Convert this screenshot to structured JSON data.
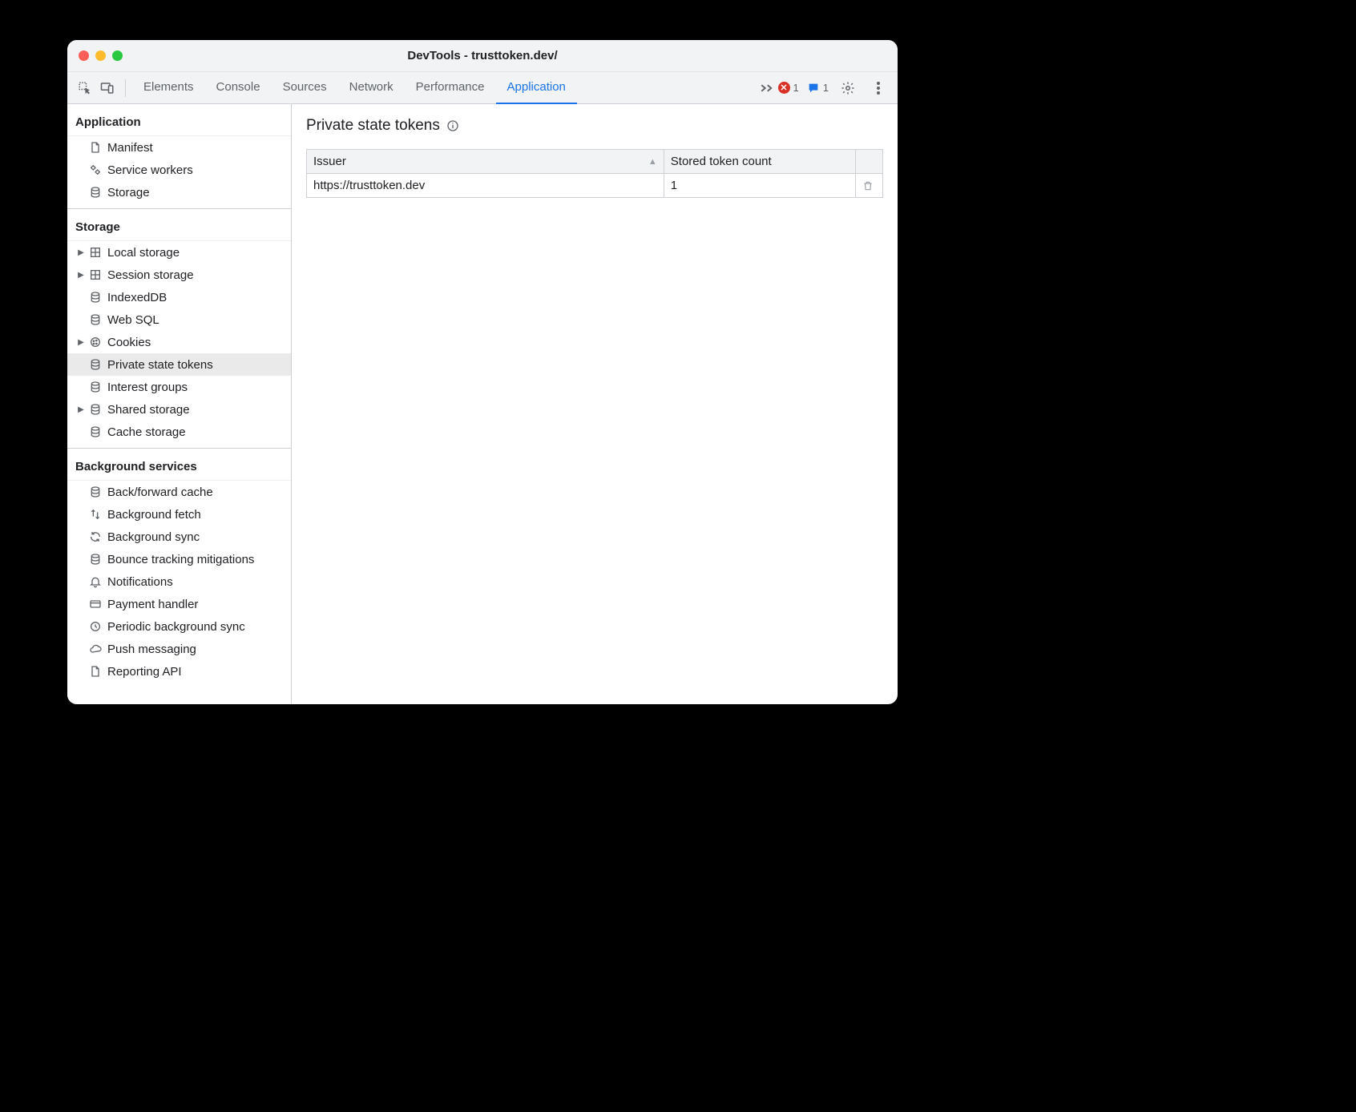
{
  "window": {
    "title": "DevTools - trusttoken.dev/"
  },
  "toolbar": {
    "tabs": [
      "Elements",
      "Console",
      "Sources",
      "Network",
      "Performance",
      "Application"
    ],
    "active_tab": "Application",
    "error_count": "1",
    "message_count": "1"
  },
  "sidebar": {
    "sections": [
      {
        "title": "Application",
        "items": [
          {
            "label": "Manifest",
            "icon": "file"
          },
          {
            "label": "Service workers",
            "icon": "gears"
          },
          {
            "label": "Storage",
            "icon": "db"
          }
        ]
      },
      {
        "title": "Storage",
        "items": [
          {
            "label": "Local storage",
            "icon": "grid",
            "expandable": true
          },
          {
            "label": "Session storage",
            "icon": "grid",
            "expandable": true
          },
          {
            "label": "IndexedDB",
            "icon": "db"
          },
          {
            "label": "Web SQL",
            "icon": "db"
          },
          {
            "label": "Cookies",
            "icon": "cookie",
            "expandable": true
          },
          {
            "label": "Private state tokens",
            "icon": "db",
            "selected": true
          },
          {
            "label": "Interest groups",
            "icon": "db"
          },
          {
            "label": "Shared storage",
            "icon": "db",
            "expandable": true
          },
          {
            "label": "Cache storage",
            "icon": "db"
          }
        ]
      },
      {
        "title": "Background services",
        "items": [
          {
            "label": "Back/forward cache",
            "icon": "db"
          },
          {
            "label": "Background fetch",
            "icon": "arrows"
          },
          {
            "label": "Background sync",
            "icon": "sync"
          },
          {
            "label": "Bounce tracking mitigations",
            "icon": "db"
          },
          {
            "label": "Notifications",
            "icon": "bell"
          },
          {
            "label": "Payment handler",
            "icon": "card"
          },
          {
            "label": "Periodic background sync",
            "icon": "clock"
          },
          {
            "label": "Push messaging",
            "icon": "cloud"
          },
          {
            "label": "Reporting API",
            "icon": "file"
          }
        ]
      }
    ]
  },
  "main": {
    "heading": "Private state tokens",
    "columns": [
      "Issuer",
      "Stored token count"
    ],
    "sorted_column": 0,
    "rows": [
      {
        "issuer": "https://trusttoken.dev",
        "count": "1"
      }
    ]
  }
}
